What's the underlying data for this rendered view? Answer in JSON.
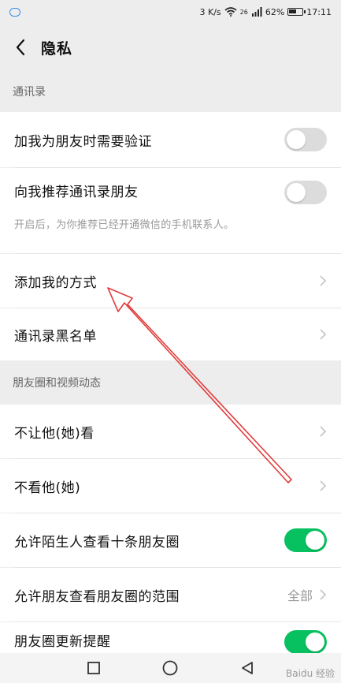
{
  "status": {
    "speed": "3 K/s",
    "signal": "26",
    "battery": "62%",
    "battery_level": 0.62,
    "time": "17:11"
  },
  "nav": {
    "title": "隐私"
  },
  "sections": {
    "contacts_header": "通讯录",
    "moments_header": "朋友圈和视频动态"
  },
  "rows": {
    "verify_friend": {
      "label": "加我为朋友时需要验证",
      "toggle_on": false
    },
    "recommend_contacts": {
      "label": "向我推荐通讯录朋友",
      "toggle_on": false,
      "note": "开启后，为你推荐已经开通微信的手机联系人。"
    },
    "add_methods": {
      "label": "添加我的方式"
    },
    "blacklist": {
      "label": "通讯录黑名单"
    },
    "hide_from": {
      "label": "不让他(她)看"
    },
    "dont_see": {
      "label": "不看他(她)"
    },
    "strangers_ten": {
      "label": "允许陌生人查看十条朋友圈",
      "toggle_on": true
    },
    "friends_range": {
      "label": "允许朋友查看朋友圈的范围",
      "value": "全部"
    },
    "moments_update": {
      "label": "朋友圈更新提醒",
      "toggle_on": true
    }
  },
  "colors": {
    "toggle_on": "#07c160",
    "toggle_off": "#dcdcdc",
    "annotation_arrow": "#e23a3a"
  },
  "watermark": "Baidu 经验"
}
